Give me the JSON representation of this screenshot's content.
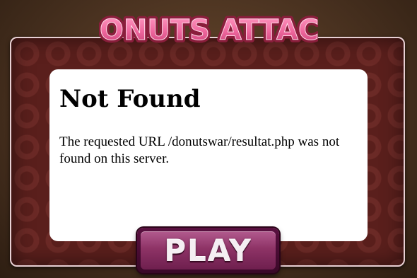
{
  "logo": {
    "title": "DONUTS ATTACK",
    "text_color": "#f06aa0",
    "outline_color": "#8a1e3c",
    "icon": "donut-logo-icon"
  },
  "error_panel": {
    "heading": "Not Found",
    "message": "The requested URL /donutswar/resultat.php was not found on this server."
  },
  "play_button": {
    "label": "PLAY",
    "color": "#8e3366"
  },
  "theme": {
    "frame_color": "#5a1f1c",
    "background_color": "#4a3220"
  }
}
